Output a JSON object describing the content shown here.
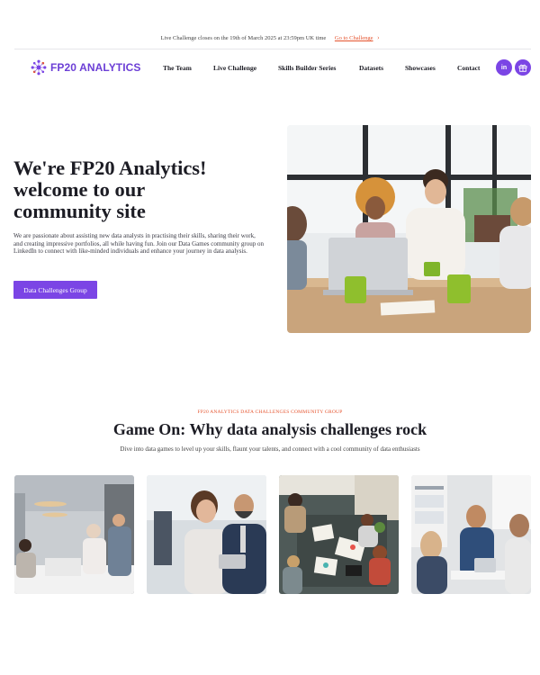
{
  "announcement": {
    "text": "Live Challenge closes on the 19th of March 2025 at 23:59pm UK time",
    "link_label": "Go to Challenge",
    "chevron": "›"
  },
  "brand": {
    "name": "FP20 ANALYTICS",
    "color": "#6c3fd6"
  },
  "nav": {
    "items": [
      {
        "label": "The Team"
      },
      {
        "label": "Live Challenge"
      },
      {
        "label": "Skills Builder Series"
      },
      {
        "label": "Datasets"
      },
      {
        "label": "Showcases"
      },
      {
        "label": "Contact"
      }
    ],
    "social": [
      {
        "icon": "linkedin-icon",
        "glyph": "in"
      },
      {
        "icon": "gift-icon",
        "glyph": "🎁"
      }
    ]
  },
  "hero": {
    "title_lines": [
      "We're FP20 Analytics!",
      "welcome to our",
      "community site"
    ],
    "description": "We are passionate about assisting new data analysts in practising their skills, sharing their work, and creating impressive portfolios, all while having fun. Join our Data Games community group on LinkedIn to connect with like-minded individuals and enhance your journey in data analysis.",
    "button_label": "Data Challenges Group"
  },
  "section": {
    "kicker": "FP20 ANALYTICS DATA CHALLENGES COMMUNITY GROUP",
    "title": "Game On: Why data analysis challenges rock",
    "subtitle": "Dive into data games to level up your skills, flaunt your talents, and connect with a cool community of data enthusiasts"
  },
  "colors": {
    "accent": "#7b45e5",
    "highlight": "#e5532d",
    "text": "#1c1c24"
  }
}
